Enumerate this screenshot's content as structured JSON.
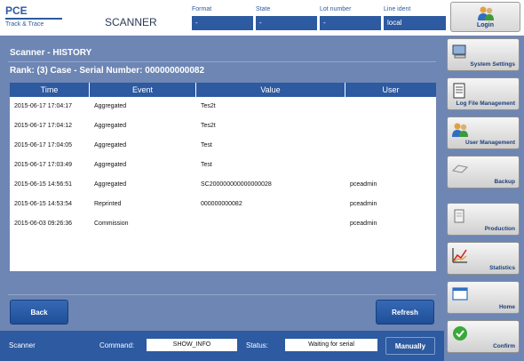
{
  "header": {
    "brand_name": "PCE",
    "brand_sub": "Track & Trace",
    "app_title": "SCANNER",
    "fields": [
      {
        "label": "Format",
        "value": "-"
      },
      {
        "label": "State",
        "value": "-"
      },
      {
        "label": "Lot number",
        "value": "-"
      },
      {
        "label": "Line ident",
        "value": "local"
      }
    ],
    "login_label": "Login"
  },
  "panel": {
    "title": "Scanner - HISTORY",
    "subtitle": "Rank: (3) Case - Serial Number: 000000000082"
  },
  "table": {
    "columns": [
      "Time",
      "Event",
      "Value",
      "User"
    ],
    "rows": [
      {
        "time": "2015-06-17 17:04:17",
        "event": "Aggregated",
        "value": "Tes2t",
        "user": ""
      },
      {
        "time": "2015-06-17 17:04:12",
        "event": "Aggregated",
        "value": "Tes2t",
        "user": ""
      },
      {
        "time": "2015-06-17 17:04:05",
        "event": "Aggregated",
        "value": "Test",
        "user": ""
      },
      {
        "time": "2015-06-17 17:03:49",
        "event": "Aggregated",
        "value": "Test",
        "user": ""
      },
      {
        "time": "2015-06-15 14:56:51",
        "event": "Aggregated",
        "value": "SC200000000000000028",
        "user": "pceadmin"
      },
      {
        "time": "2015-06-15 14:53:54",
        "event": "Reprinted",
        "value": "000000000082",
        "user": "pceadmin"
      },
      {
        "time": "2015-06-03 09:26:36",
        "event": "Commission",
        "value": "",
        "user": "pceadmin"
      }
    ]
  },
  "buttons": {
    "back": "Back",
    "refresh": "Refresh"
  },
  "sidebar": {
    "items": [
      {
        "label": "System Settings",
        "icon": "computer-icon"
      },
      {
        "label": "Log File Management",
        "icon": "log-file-icon"
      },
      {
        "label": "User Management",
        "icon": "users-icon"
      },
      {
        "label": "Backup",
        "icon": "backup-icon"
      },
      {
        "label": "Production",
        "icon": "production-icon"
      },
      {
        "label": "Statistics",
        "icon": "statistics-icon"
      },
      {
        "label": "Home",
        "icon": "home-icon"
      },
      {
        "label": "Confirm",
        "icon": "confirm-icon"
      }
    ]
  },
  "status": {
    "mode": "Scanner",
    "command_label": "Command:",
    "command_value": "SHOW_INFO",
    "status_label": "Status:",
    "status_value": "Waiting for serial",
    "manual_label": "Manually"
  },
  "colors": {
    "primary": "#2d5aa0",
    "panel": "#6e86b4",
    "header_text": "#2d5aa0"
  }
}
